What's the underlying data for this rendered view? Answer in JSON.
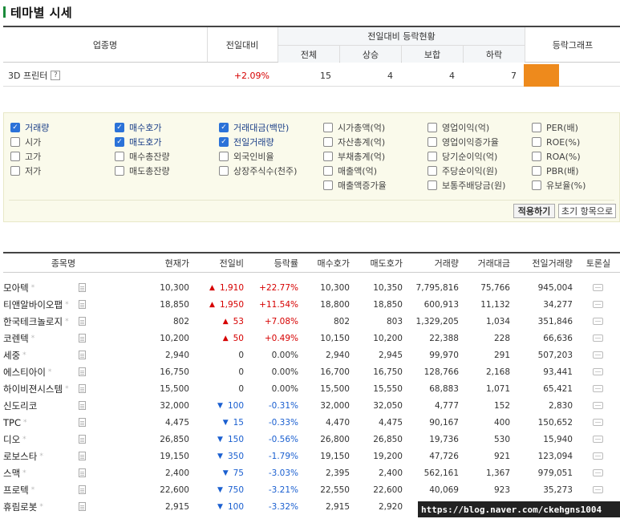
{
  "page_title": "테마별 시세",
  "summary": {
    "headers": {
      "name": "업종명",
      "change": "전일대비",
      "group": "전일대비 등락현황",
      "total": "전체",
      "up": "상승",
      "flat": "보합",
      "down": "하락",
      "graph": "등락그래프"
    },
    "row": {
      "name": "3D 프린터",
      "help": "?",
      "change": "+2.09%",
      "total": "15",
      "up": "4",
      "flat": "4",
      "down": "7"
    }
  },
  "options": [
    {
      "label": "거래량",
      "checked": true
    },
    {
      "label": "매수호가",
      "checked": true
    },
    {
      "label": "거래대금(백만)",
      "checked": true
    },
    {
      "label": "시가총액(억)",
      "checked": false
    },
    {
      "label": "영업이익(억)",
      "checked": false
    },
    {
      "label": "PER(배)",
      "checked": false
    },
    {
      "label": "시가",
      "checked": false
    },
    {
      "label": "매도호가",
      "checked": true
    },
    {
      "label": "전일거래량",
      "checked": true
    },
    {
      "label": "자산총계(억)",
      "checked": false
    },
    {
      "label": "영업이익증가율",
      "checked": false
    },
    {
      "label": "ROE(%)",
      "checked": false
    },
    {
      "label": "고가",
      "checked": false
    },
    {
      "label": "매수총잔량",
      "checked": false
    },
    {
      "label": "외국인비율",
      "checked": false
    },
    {
      "label": "부채총계(억)",
      "checked": false
    },
    {
      "label": "당기순이익(억)",
      "checked": false
    },
    {
      "label": "ROA(%)",
      "checked": false
    },
    {
      "label": "저가",
      "checked": false
    },
    {
      "label": "매도총잔량",
      "checked": false
    },
    {
      "label": "상장주식수(천주)",
      "checked": false
    },
    {
      "label": "매출액(억)",
      "checked": false
    },
    {
      "label": "주당순이익(원)",
      "checked": false
    },
    {
      "label": "PBR(배)",
      "checked": false
    },
    {
      "label": "매출액증가율",
      "checked": false
    },
    {
      "label": "보통주배당금(원)",
      "checked": false
    },
    {
      "label": "유보율(%)",
      "checked": false
    }
  ],
  "buttons": {
    "apply": "적용하기",
    "reset": "초기 항목으로"
  },
  "stock_headers": [
    "종목명",
    "현재가",
    "전일비",
    "등락률",
    "매수호가",
    "매도호가",
    "거래량",
    "거래대금",
    "전일거래량",
    "토론실"
  ],
  "stocks": [
    {
      "name": "모아텍",
      "star": "*",
      "price": "10,300",
      "dir": "up",
      "arrow": "▲",
      "diff": "1,910",
      "rate": "+22.77%",
      "bid": "10,300",
      "ask": "10,350",
      "vol": "7,795,816",
      "amt": "75,766",
      "prev_vol": "945,004"
    },
    {
      "name": "티앤알바이오팹",
      "star": "*",
      "price": "18,850",
      "dir": "up",
      "arrow": "▲",
      "diff": "1,950",
      "rate": "+11.54%",
      "bid": "18,800",
      "ask": "18,850",
      "vol": "600,913",
      "amt": "11,132",
      "prev_vol": "34,277"
    },
    {
      "name": "한국테크놀로지",
      "star": "*",
      "price": "802",
      "dir": "up",
      "arrow": "▲",
      "diff": "53",
      "rate": "+7.08%",
      "bid": "802",
      "ask": "803",
      "vol": "1,329,205",
      "amt": "1,034",
      "prev_vol": "351,846"
    },
    {
      "name": "코렌텍",
      "star": "*",
      "price": "10,200",
      "dir": "up",
      "arrow": "▲",
      "diff": "50",
      "rate": "+0.49%",
      "bid": "10,150",
      "ask": "10,200",
      "vol": "22,388",
      "amt": "228",
      "prev_vol": "66,636"
    },
    {
      "name": "세중",
      "star": "*",
      "price": "2,940",
      "dir": "flat",
      "arrow": "",
      "diff": "0",
      "rate": "0.00%",
      "bid": "2,940",
      "ask": "2,945",
      "vol": "99,970",
      "amt": "291",
      "prev_vol": "507,203"
    },
    {
      "name": "에스티아이",
      "star": "*",
      "price": "16,750",
      "dir": "flat",
      "arrow": "",
      "diff": "0",
      "rate": "0.00%",
      "bid": "16,700",
      "ask": "16,750",
      "vol": "128,766",
      "amt": "2,168",
      "prev_vol": "93,441"
    },
    {
      "name": "하이비젼시스템",
      "star": "*",
      "price": "15,500",
      "dir": "flat",
      "arrow": "",
      "diff": "0",
      "rate": "0.00%",
      "bid": "15,500",
      "ask": "15,550",
      "vol": "68,883",
      "amt": "1,071",
      "prev_vol": "65,421"
    },
    {
      "name": "신도리코",
      "star": "",
      "price": "32,000",
      "dir": "dn",
      "arrow": "▼",
      "diff": "100",
      "rate": "-0.31%",
      "bid": "32,000",
      "ask": "32,050",
      "vol": "4,777",
      "amt": "152",
      "prev_vol": "2,830"
    },
    {
      "name": "TPC",
      "star": "*",
      "price": "4,475",
      "dir": "dn",
      "arrow": "▼",
      "diff": "15",
      "rate": "-0.33%",
      "bid": "4,470",
      "ask": "4,475",
      "vol": "90,167",
      "amt": "400",
      "prev_vol": "150,652"
    },
    {
      "name": "디오",
      "star": "*",
      "price": "26,850",
      "dir": "dn",
      "arrow": "▼",
      "diff": "150",
      "rate": "-0.56%",
      "bid": "26,800",
      "ask": "26,850",
      "vol": "19,736",
      "amt": "530",
      "prev_vol": "15,940"
    },
    {
      "name": "로보스타",
      "star": "*",
      "price": "19,150",
      "dir": "dn",
      "arrow": "▼",
      "diff": "350",
      "rate": "-1.79%",
      "bid": "19,150",
      "ask": "19,200",
      "vol": "47,726",
      "amt": "921",
      "prev_vol": "123,094"
    },
    {
      "name": "스맥",
      "star": "*",
      "price": "2,400",
      "dir": "dn",
      "arrow": "▼",
      "diff": "75",
      "rate": "-3.03%",
      "bid": "2,395",
      "ask": "2,400",
      "vol": "562,161",
      "amt": "1,367",
      "prev_vol": "979,051"
    },
    {
      "name": "프로텍",
      "star": "*",
      "price": "22,600",
      "dir": "dn",
      "arrow": "▼",
      "diff": "750",
      "rate": "-3.21%",
      "bid": "22,550",
      "ask": "22,600",
      "vol": "40,069",
      "amt": "923",
      "prev_vol": "35,273"
    },
    {
      "name": "휴림로봇",
      "star": "*",
      "price": "2,915",
      "dir": "dn",
      "arrow": "▼",
      "diff": "100",
      "rate": "-3.32%",
      "bid": "2,915",
      "ask": "2,920",
      "vol": "11,",
      "amt": "",
      "prev_vol": ""
    }
  ],
  "watermark": "https://blog.naver.com/ckehgns1004",
  "colors": {
    "up": "#d60000",
    "down": "#1a5fd0",
    "graph_bar": "#ee8a1c",
    "checkbox": "#2b72d8"
  }
}
